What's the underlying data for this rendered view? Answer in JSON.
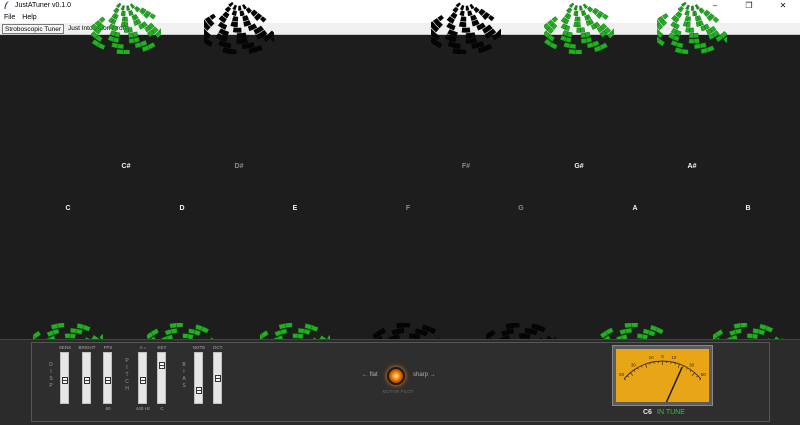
{
  "window": {
    "title": "JustATuner v0.1.0",
    "minimize": "–",
    "restore": "❐",
    "close": "✕"
  },
  "menu": [
    "File",
    "Help"
  ],
  "tabs": [
    "Stroboscopic Tuner",
    "Just Intonation Drone"
  ],
  "colors": {
    "active_strobe": "#22b022",
    "inactive_strobe": "#050505",
    "label_active": "#f2f2f2",
    "label_inactive": "#8a8a8a",
    "meter_face": "#e8a515",
    "in_tune": "#36c236"
  },
  "strobes": {
    "upper": [
      {
        "note": "C#",
        "active": true
      },
      {
        "note": "D#",
        "active": false
      },
      {
        "note": "F#",
        "active": false
      },
      {
        "note": "G#",
        "active": true
      },
      {
        "note": "A#",
        "active": true
      }
    ],
    "lower": [
      {
        "note": "C",
        "active": true
      },
      {
        "note": "D",
        "active": true
      },
      {
        "note": "E",
        "active": true
      },
      {
        "note": "F",
        "active": false
      },
      {
        "note": "G",
        "active": false
      },
      {
        "note": "A",
        "active": true
      },
      {
        "note": "B",
        "active": true
      }
    ]
  },
  "controls": {
    "disp_label": "DISP",
    "pitch_label": "PITCH",
    "bias_label": "BIAS",
    "sliders": [
      {
        "label": "SENS",
        "value": "",
        "level": 0.45
      },
      {
        "label": "BRIGHT",
        "value": "",
        "level": 0.45
      },
      {
        "label": "FPS",
        "value": "60",
        "level": 0.45
      },
      {
        "label": "A =",
        "value": "440 Hz",
        "level": 0.45
      },
      {
        "label": "KEY",
        "value": "C",
        "level": 0.8
      },
      {
        "label": "NOTE",
        "value": "",
        "level": 0.2
      },
      {
        "label": "OCT.",
        "value": "",
        "level": 0.5
      }
    ]
  },
  "center": {
    "flat": "← flat",
    "sharp": "sharp →",
    "motor_label": "MOTOR PILOT"
  },
  "meter": {
    "scale": [
      "50",
      "30",
      "10",
      "0",
      "10",
      "30",
      "50"
    ],
    "cents": 4,
    "note": "C6",
    "status": "IN TUNE"
  }
}
